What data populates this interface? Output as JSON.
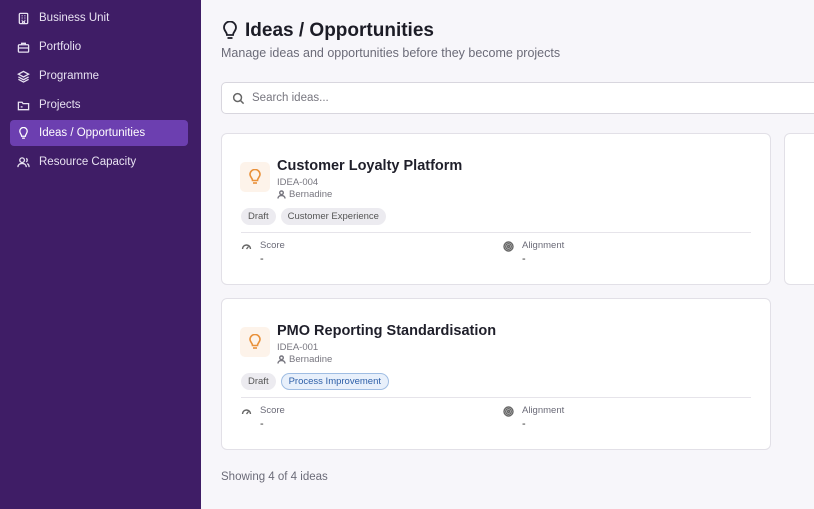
{
  "sidebar": {
    "items": [
      {
        "label": "Business Unit",
        "icon": "building-icon"
      },
      {
        "label": "Portfolio",
        "icon": "briefcase-icon"
      },
      {
        "label": "Programme",
        "icon": "layers-icon"
      },
      {
        "label": "Projects",
        "icon": "folder-icon"
      },
      {
        "label": "Ideas / Opportunities",
        "icon": "lightbulb-icon",
        "active": true
      },
      {
        "label": "Resource Capacity",
        "icon": "users-icon"
      }
    ]
  },
  "header": {
    "title": "Ideas / Opportunities",
    "subtitle": "Manage ideas and opportunities before they become projects"
  },
  "search": {
    "placeholder": "Search ideas..."
  },
  "cards": [
    {
      "title": "Customer Loyalty Platform",
      "code": "IDEA-004",
      "owner": "Bernadine",
      "status": "Draft",
      "category": "Customer Experience",
      "score_label": "Score",
      "score_value": "-",
      "alignment_label": "Alignment",
      "alignment_value": "-"
    },
    {
      "title": "PMO Reporting Standardisation",
      "code": "IDEA-001",
      "owner": "Bernadine",
      "status": "Draft",
      "category": "Process Improvement",
      "score_label": "Score",
      "score_value": "-",
      "alignment_label": "Alignment",
      "alignment_value": "-"
    }
  ],
  "footer": {
    "count_text": "Showing 4 of 4 ideas"
  },
  "colors": {
    "sidebar_bg": "#3f1d66",
    "active_item": "#6c3fb0",
    "lamp_accent": "#e9913a"
  }
}
